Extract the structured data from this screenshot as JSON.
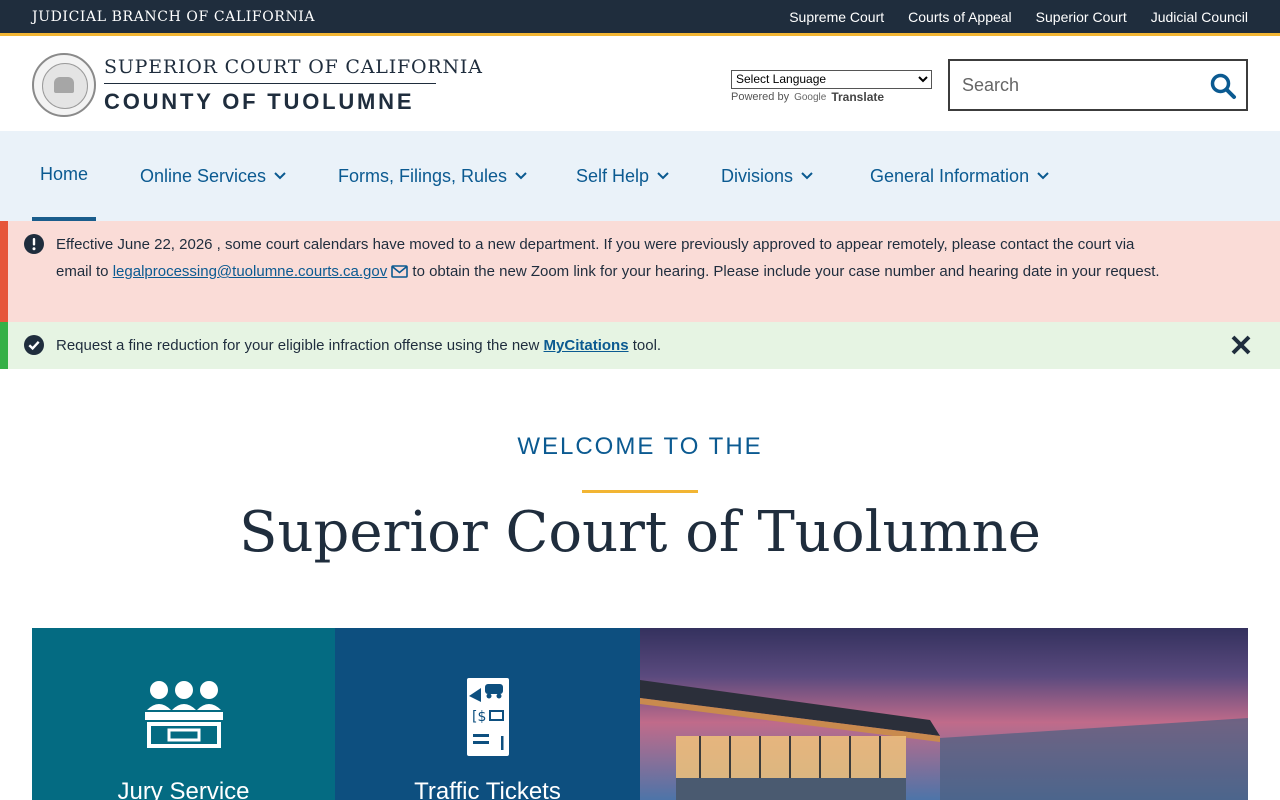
{
  "topbar": {
    "branch": "JUDICIAL BRANCH OF CALIFORNIA",
    "links": [
      "Supreme Court",
      "Courts of Appeal",
      "Superior Court",
      "Judicial Council"
    ]
  },
  "header": {
    "logo_line1": "SUPERIOR COURT OF CALIFORNIA",
    "logo_line2": "COUNTY OF TUOLUMNE",
    "seal_text": "JUDICIAL BRANCH OF CALIFORNIA",
    "language_select": "Select Language",
    "powered_by": "Powered by",
    "google": "Google",
    "translate": "Translate",
    "search_placeholder": "Search"
  },
  "nav": {
    "items": [
      {
        "label": "Home"
      },
      {
        "label": "Online Services"
      },
      {
        "label": "Forms, Filings, Rules"
      },
      {
        "label": "Self Help"
      },
      {
        "label": "Divisions"
      },
      {
        "label": "General Information"
      }
    ]
  },
  "alerts": {
    "red": {
      "date": "Effective June 22, 2026",
      "text1": " , some court calendars have moved to a new department. If you were previously approved to appear remotely, please contact the court via email to ",
      "email": "legalprocessing@tuolumne.courts.ca.gov",
      "text2": " to obtain the new Zoom link for your hearing. Please include your case number and hearing date in your request."
    },
    "green": {
      "text1": "Request a fine reduction for your eligible infraction offense using the new ",
      "link": "MyCitations",
      "text2": " tool."
    }
  },
  "welcome": {
    "kicker": "WELCOME TO THE",
    "title": "Superior Court of Tuolumne"
  },
  "tiles": [
    {
      "label": "Jury Service"
    },
    {
      "label": "Traffic Tickets"
    }
  ],
  "colors": {
    "topbar": "#1f2d3d",
    "accent_gold": "#f2b533",
    "link_blue": "#0b5a91",
    "nav_bg": "#eaf2f9",
    "alert_red_bg": "#fadcd7",
    "alert_green_bg": "#e6f4e3",
    "tile_jury": "#046b82",
    "tile_traffic": "#0d4f7f"
  }
}
